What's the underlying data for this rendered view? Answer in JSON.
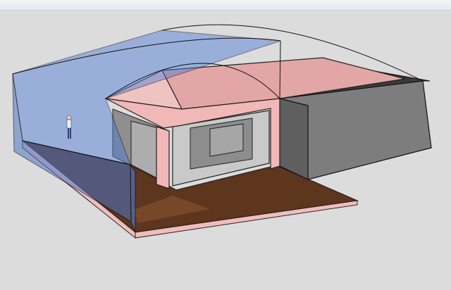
{
  "app": {
    "type": "3d-modeling-viewport"
  },
  "viewport": {
    "background_color": "#dcdcdc",
    "scene": "3d-house-model"
  },
  "colors": {
    "translucent_blue": "#3f6fd1",
    "roof_pink": "#e3a6a6",
    "wall_pink": "#f2b7b7",
    "concrete": "#c7c7c7",
    "dark_block": "#7a7a7a",
    "wood_floor": "#6b3d22",
    "edge": "#111111"
  },
  "scene_elements": {
    "figure_label": "person-figure-icon"
  }
}
